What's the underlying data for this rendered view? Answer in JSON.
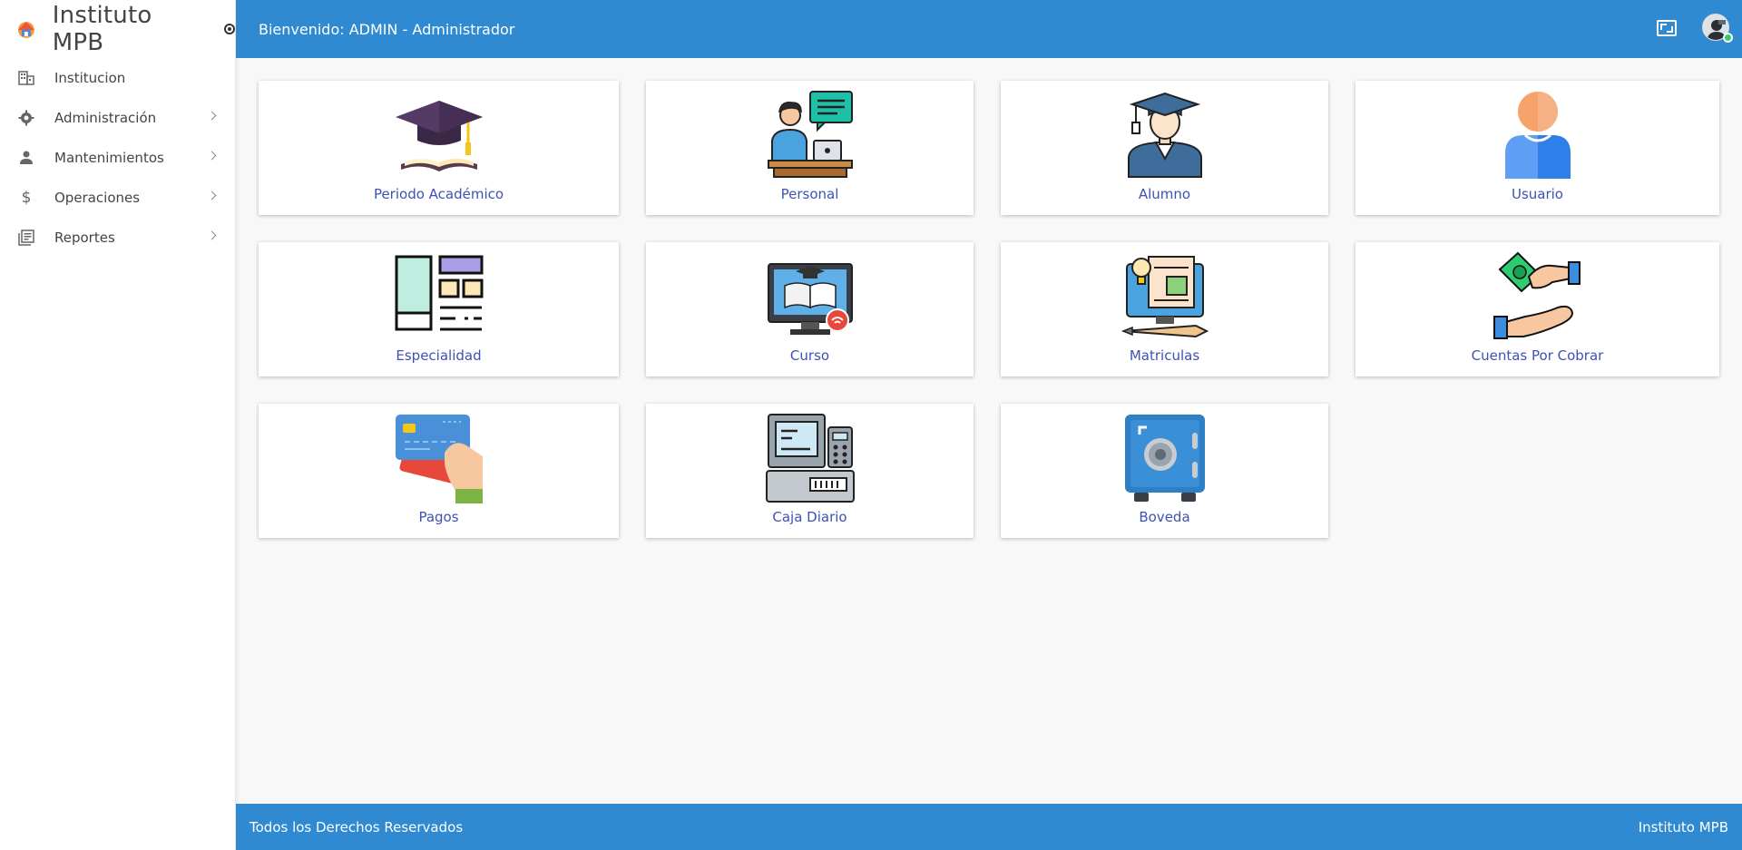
{
  "app": {
    "brand_name": "Instituto MPB"
  },
  "sidebar": {
    "items": [
      {
        "label": "Institucion",
        "icon": "building-icon",
        "has_submenu": false
      },
      {
        "label": "Administración",
        "icon": "gear-icon",
        "has_submenu": true
      },
      {
        "label": "Mantenimientos",
        "icon": "person-icon",
        "has_submenu": true
      },
      {
        "label": "Operaciones",
        "icon": "dollar-icon",
        "has_submenu": true
      },
      {
        "label": "Reportes",
        "icon": "report-icon",
        "has_submenu": true
      }
    ]
  },
  "topbar": {
    "welcome": "Bienvenido: ADMIN - Administrador"
  },
  "cards": [
    {
      "label": "Periodo Académico",
      "icon": "graduation-cap-icon"
    },
    {
      "label": "Personal",
      "icon": "staff-desk-icon"
    },
    {
      "label": "Alumno",
      "icon": "student-icon"
    },
    {
      "label": "Usuario",
      "icon": "user-icon"
    },
    {
      "label": "Especialidad",
      "icon": "layout-icon"
    },
    {
      "label": "Curso",
      "icon": "computer-course-icon"
    },
    {
      "label": "Matriculas",
      "icon": "enrollment-icon"
    },
    {
      "label": "Cuentas Por Cobrar",
      "icon": "money-hands-icon"
    },
    {
      "label": "Pagos",
      "icon": "credit-card-icon"
    },
    {
      "label": "Caja Diario",
      "icon": "cash-register-icon"
    },
    {
      "label": "Boveda",
      "icon": "safe-icon"
    }
  ],
  "footer": {
    "rights": "Todos los Derechos Reservados",
    "brand": "Instituto MPB"
  },
  "colors": {
    "primary": "#2f8ad2",
    "card_label": "#3f51b5",
    "background": "#f8f8f8"
  }
}
